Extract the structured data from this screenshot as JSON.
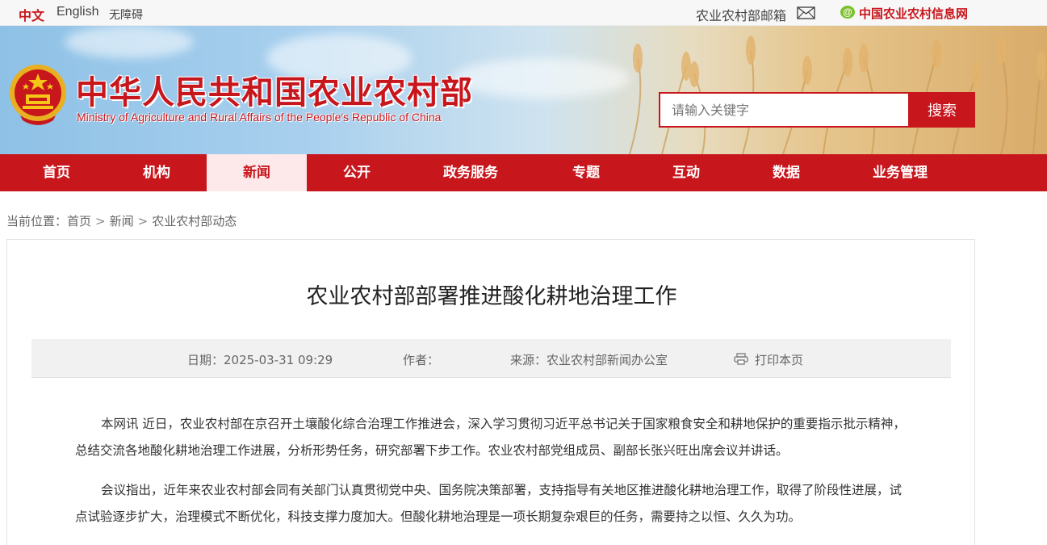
{
  "topbar": {
    "lang_cn": "中文",
    "lang_en": "English",
    "accessibility": "无障碍",
    "mailbox": "农业农村部邮箱",
    "info_network": "中国农业农村信息网"
  },
  "header": {
    "title_cn": "中华人民共和国农业农村部",
    "title_en": "Ministry of Agriculture and Rural Affairs of the People's Republic of China",
    "search_placeholder": "请输入关键字",
    "search_button": "搜索"
  },
  "nav": {
    "items": [
      {
        "label": "首页"
      },
      {
        "label": "机构"
      },
      {
        "label": "新闻"
      },
      {
        "label": "公开"
      },
      {
        "label": "政务服务"
      },
      {
        "label": "专题"
      },
      {
        "label": "互动"
      },
      {
        "label": "数据"
      },
      {
        "label": "业务管理"
      }
    ],
    "active": "新闻"
  },
  "breadcrumb": {
    "prefix": "当前位置：",
    "items": [
      "首页",
      "新闻",
      "农业农村部动态"
    ]
  },
  "article": {
    "title": "农业农村部部署推进酸化耕地治理工作",
    "date": "日期：2025-03-31 09:29",
    "author": "作者：",
    "source": "来源：农业农村部新闻办公室",
    "print": "打印本页",
    "paragraphs": [
      "本网讯 近日，农业农村部在京召开土壤酸化综合治理工作推进会，深入学习贯彻习近平总书记关于国家粮食安全和耕地保护的重要指示批示精神，总结交流各地酸化耕地治理工作进展，分析形势任务，研究部署下步工作。农业农村部党组成员、副部长张兴旺出席会议并讲话。",
      "会议指出，近年来农业农村部会同有关部门认真贯彻党中央、国务院决策部署，支持指导有关地区推进酸化耕地治理工作，取得了阶段性进展，试点试验逐步扩大，治理模式不断优化，科技支撑力度加大。但酸化耕地治理是一项长期复杂艰巨的任务，需要持之以恒、久久为功。"
    ]
  },
  "colors": {
    "brand_red": "#c8161d",
    "nav_active_bg": "#fde9ea"
  }
}
